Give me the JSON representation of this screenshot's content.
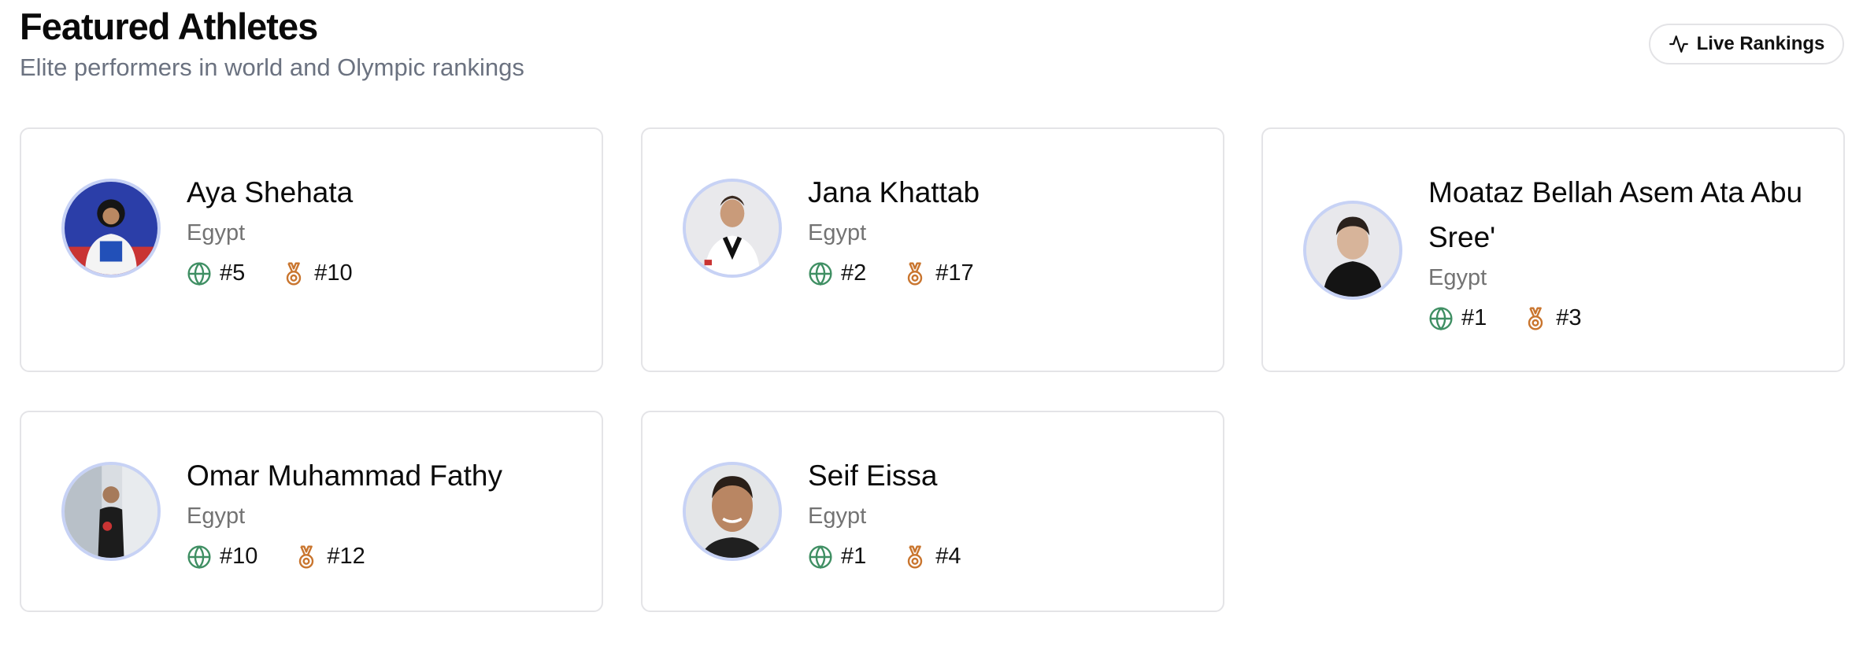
{
  "header": {
    "title": "Featured Athletes",
    "subtitle": "Elite performers in world and Olympic rankings",
    "live_button_label": "Live Rankings"
  },
  "colors": {
    "world_icon": "#3f8f63",
    "olympic_icon": "#c9752e",
    "avatar_ring": "#c7d2f5"
  },
  "athletes": [
    {
      "name": "Aya Shehata",
      "country": "Egypt",
      "world_rank": "#5",
      "olympic_rank": "#10"
    },
    {
      "name": "Jana Khattab",
      "country": "Egypt",
      "world_rank": "#2",
      "olympic_rank": "#17"
    },
    {
      "name": "Moataz Bellah Asem Ata Abu Sree'",
      "country": "Egypt",
      "world_rank": "#1",
      "olympic_rank": "#3"
    },
    {
      "name": "Omar Muhammad Fathy",
      "country": "Egypt",
      "world_rank": "#10",
      "olympic_rank": "#12"
    },
    {
      "name": "Seif Eissa",
      "country": "Egypt",
      "world_rank": "#1",
      "olympic_rank": "#4"
    }
  ]
}
